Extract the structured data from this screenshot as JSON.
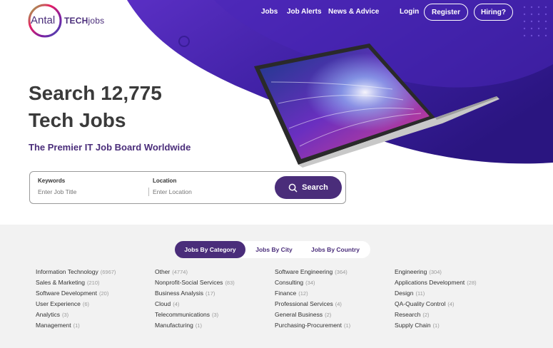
{
  "header": {
    "logo_word": "Antal",
    "logo_tech": "TECH",
    "logo_jobs": "jobs",
    "nav": {
      "jobs": "Jobs",
      "job_alerts": "Job Alerts",
      "news": "News & Advice",
      "login": "Login",
      "register": "Register",
      "hiring": "Hiring?"
    }
  },
  "hero": {
    "title_line1": "Search 12,775",
    "title_line2": "Tech Jobs",
    "subtitle": "The Premier IT Job Board Worldwide"
  },
  "search": {
    "keywords_label": "Keywords",
    "keywords_placeholder": "Enter Job Title",
    "location_label": "Location",
    "location_placeholder": "Enter Location",
    "button_label": "Search"
  },
  "tabs": {
    "category": "Jobs By Category",
    "city": "Jobs By City",
    "country": "Jobs By Country"
  },
  "categories": {
    "col1": [
      {
        "name": "Information Technology",
        "count": "(6967)"
      },
      {
        "name": "Sales & Marketing",
        "count": "(210)"
      },
      {
        "name": "Software Development",
        "count": "(20)"
      },
      {
        "name": "User Experience",
        "count": "(6)"
      },
      {
        "name": "Analytics",
        "count": "(3)"
      },
      {
        "name": "Management",
        "count": "(1)"
      }
    ],
    "col2": [
      {
        "name": "Other",
        "count": "(4774)"
      },
      {
        "name": "Nonprofit-Social Services",
        "count": "(83)"
      },
      {
        "name": "Business Analysis",
        "count": "(17)"
      },
      {
        "name": "Cloud",
        "count": "(4)"
      },
      {
        "name": "Telecommunications",
        "count": "(3)"
      },
      {
        "name": "Manufacturing",
        "count": "(1)"
      }
    ],
    "col3": [
      {
        "name": "Software Engineering",
        "count": "(364)"
      },
      {
        "name": "Consulting",
        "count": "(34)"
      },
      {
        "name": "Finance",
        "count": "(12)"
      },
      {
        "name": "Professional Services",
        "count": "(4)"
      },
      {
        "name": "General Business",
        "count": "(2)"
      },
      {
        "name": "Purchasing-Procurement",
        "count": "(1)"
      }
    ],
    "col4": [
      {
        "name": "Engineering",
        "count": "(304)"
      },
      {
        "name": "Applications Development",
        "count": "(28)"
      },
      {
        "name": "Design",
        "count": "(11)"
      },
      {
        "name": "QA-Quality Control",
        "count": "(4)"
      },
      {
        "name": "Research",
        "count": "(2)"
      },
      {
        "name": "Supply Chain",
        "count": "(1)"
      }
    ]
  },
  "colors": {
    "brand_purple": "#4a2d7a",
    "hero_purple": "#3b1fa0",
    "section_bg": "#f2f2f2"
  }
}
